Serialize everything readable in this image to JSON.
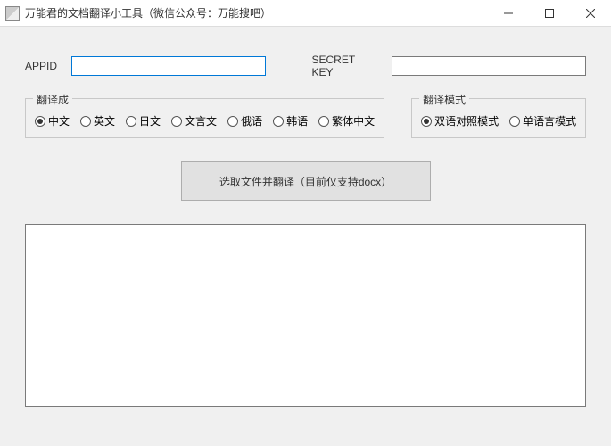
{
  "window": {
    "title": "万能君的文档翻译小工具（微信公众号：万能搜吧）"
  },
  "fields": {
    "appid_label": "APPID",
    "appid_value": "",
    "secret_label": "SECRET KEY",
    "secret_value": ""
  },
  "group_translate": {
    "legend": "翻译成",
    "options": [
      {
        "label": "中文",
        "checked": true
      },
      {
        "label": "英文",
        "checked": false
      },
      {
        "label": "日文",
        "checked": false
      },
      {
        "label": "文言文",
        "checked": false
      },
      {
        "label": "俄语",
        "checked": false
      },
      {
        "label": "韩语",
        "checked": false
      },
      {
        "label": "繁体中文",
        "checked": false
      }
    ]
  },
  "group_mode": {
    "legend": "翻译模式",
    "options": [
      {
        "label": "双语对照模式",
        "checked": true
      },
      {
        "label": "单语言模式",
        "checked": false
      }
    ]
  },
  "main_button": "选取文件并翻译（目前仅支持docx）",
  "output_value": ""
}
